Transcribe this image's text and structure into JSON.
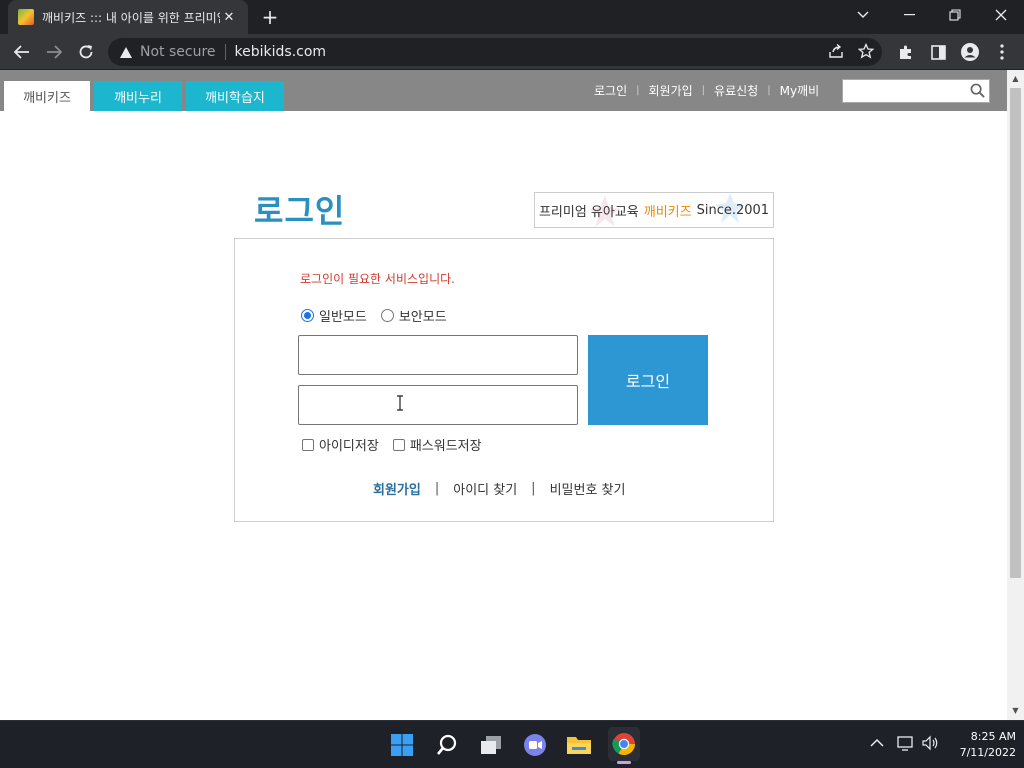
{
  "browser": {
    "tab_title": "깨비키즈 ::: 내 아이를 위한 프리미엄",
    "not_secure": "Not secure",
    "url": "kebikids.com"
  },
  "site": {
    "tabs": [
      {
        "label": "깨비키즈"
      },
      {
        "label": "깨비누리"
      },
      {
        "label": "깨비학습지"
      }
    ],
    "top_links": [
      "로그인",
      "회원가입",
      "유료신청",
      "My깨비"
    ],
    "search_placeholder": ""
  },
  "login": {
    "title": "로그인",
    "banner_prefix": "프리미엄 유아교육",
    "banner_brand": "깨비키즈",
    "banner_suffix": "Since.2001",
    "required_message": "로그인이 필요한 서비스입니다.",
    "mode_normal": "일반모드",
    "mode_secure": "보안모드",
    "id_value": "",
    "password_value": "",
    "login_button": "로그인",
    "save_id": "아이디저장",
    "save_password": "패스워드저장",
    "join_link": "회원가입",
    "find_id_link": "아이디 찾기",
    "find_password_link": "비밀번호 찾기"
  },
  "taskbar": {
    "time": "8:25 AM",
    "date": "7/11/2022"
  },
  "colors": {
    "accent_title": "#2b8fc0",
    "tab_cyan": "#1cb6cf",
    "login_button": "#2d97d3",
    "error_text": "#d23a2e",
    "brand_orange": "#ee8a00"
  }
}
